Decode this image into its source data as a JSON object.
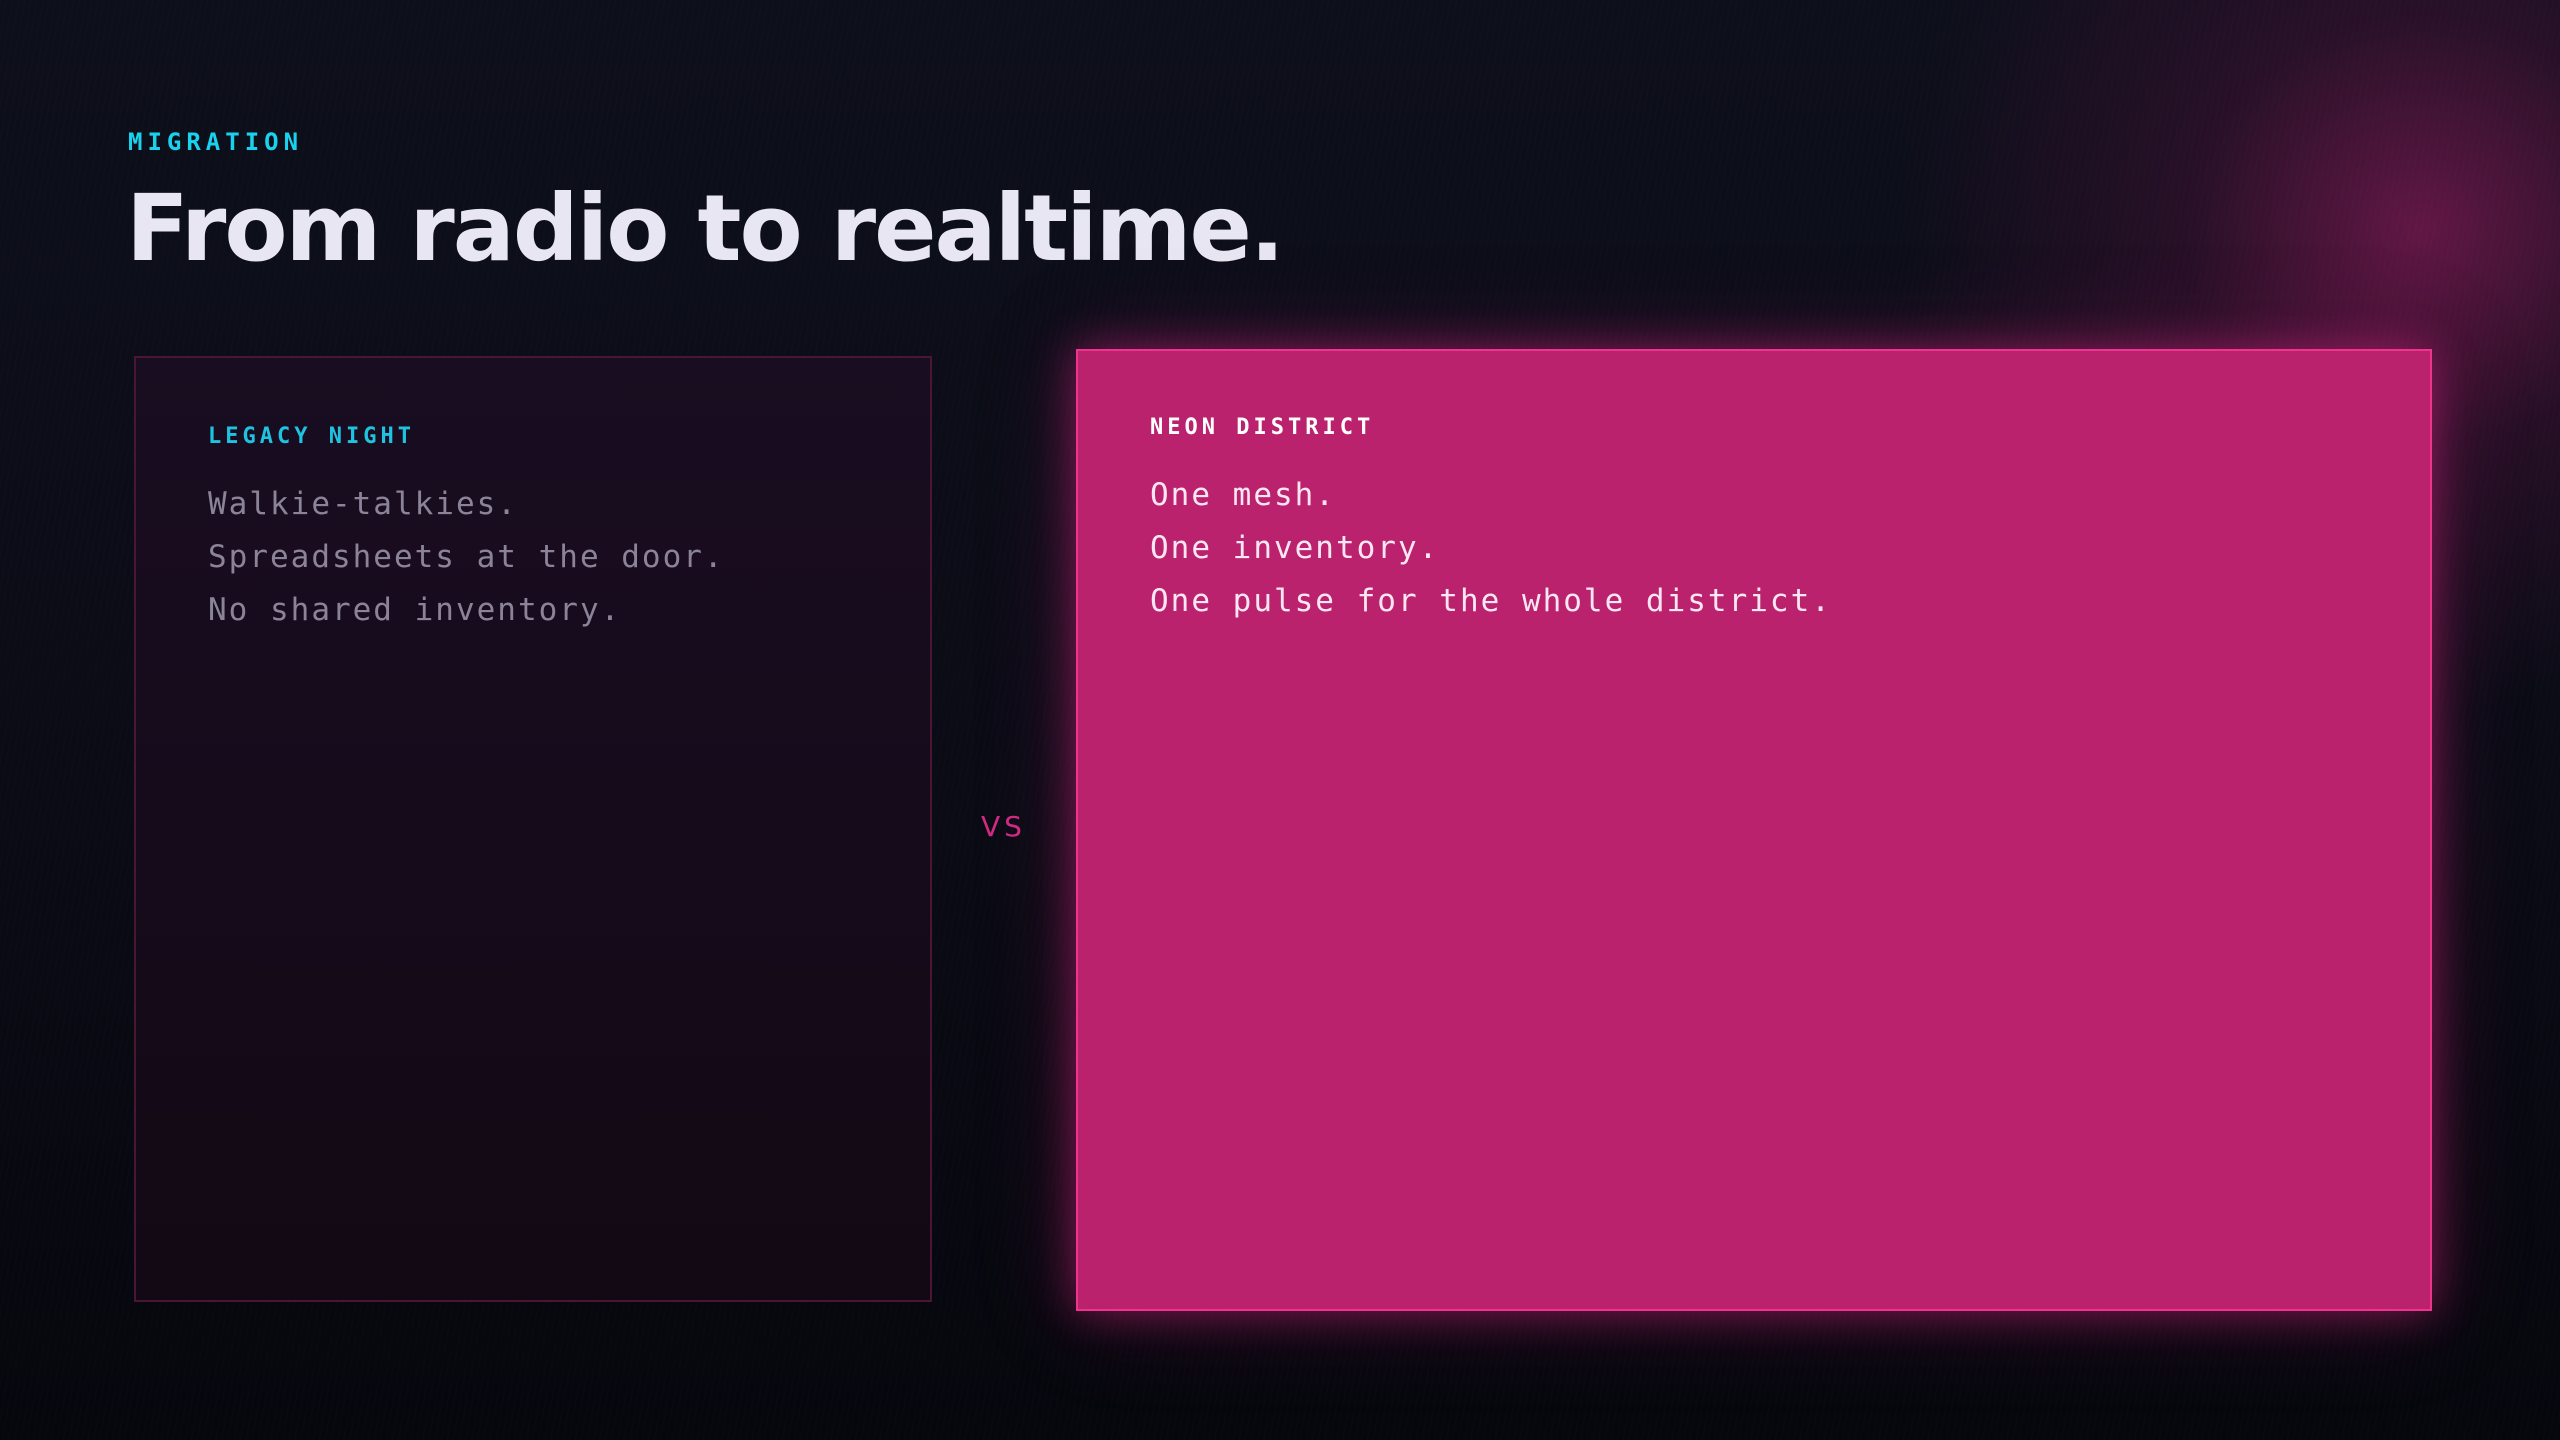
{
  "slide": {
    "eyebrow": "MIGRATION",
    "title": "From radio to realtime.",
    "separator": "VS"
  },
  "comparison": {
    "legacy": {
      "label": "LEGACY NIGHT",
      "lines": [
        "Walkie-talkies.",
        "Spreadsheets at the door.",
        "No shared inventory."
      ]
    },
    "neon": {
      "label": "NEON DISTRICT",
      "lines": [
        "One mesh.",
        "One inventory.",
        "One pulse for the whole district."
      ]
    }
  },
  "colors": {
    "background": "#090a12",
    "accent_cyan": "#19d3ee",
    "accent_magenta": "#bb226e",
    "magenta_border": "#f0338f",
    "title": "#e8e6f2"
  }
}
